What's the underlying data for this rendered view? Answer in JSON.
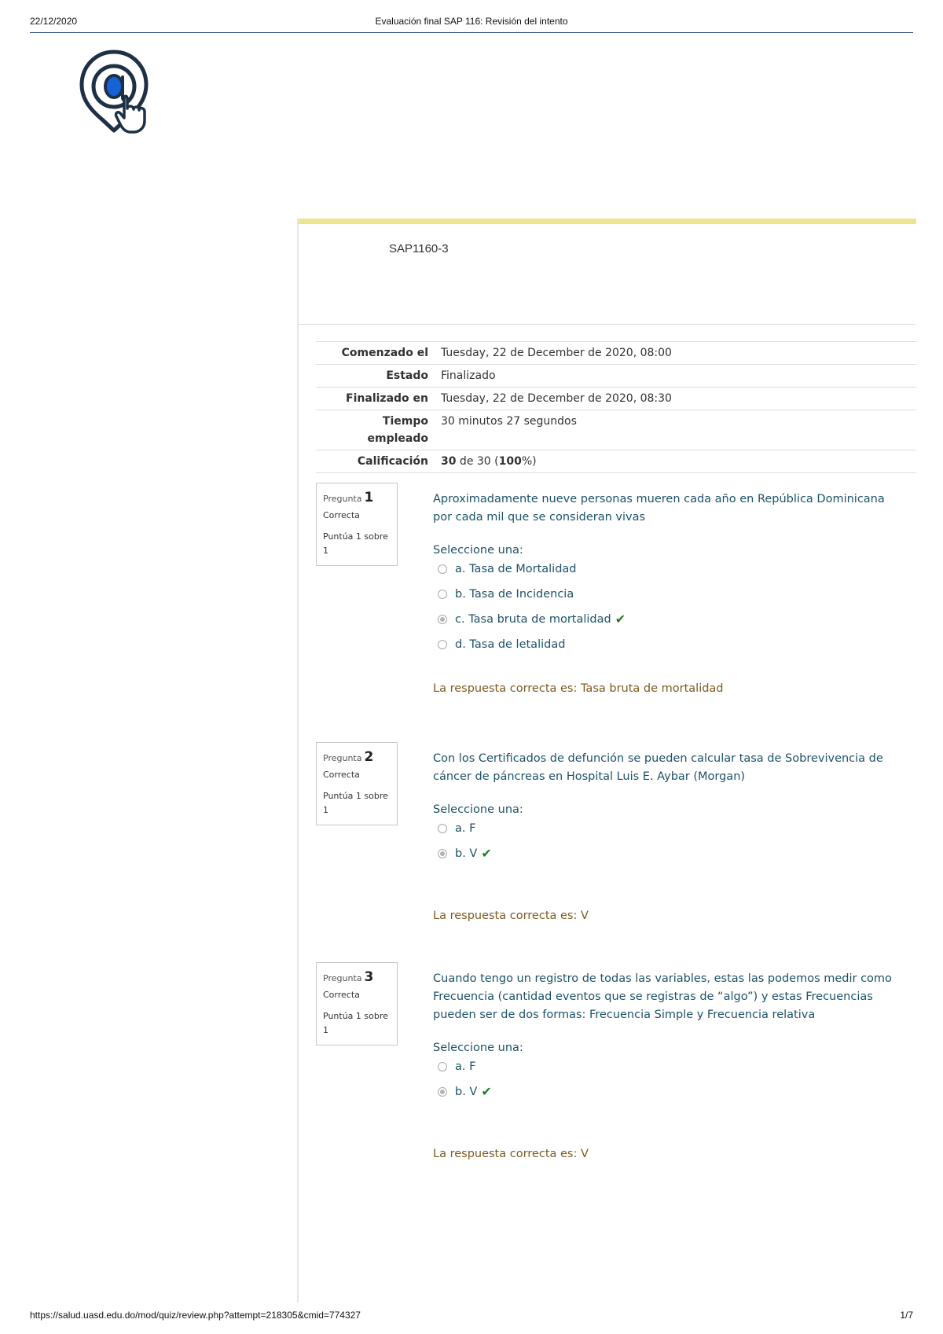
{
  "print_header": {
    "date": "22/12/2020",
    "title": "Evaluación final SAP 116: Revisión del intento"
  },
  "logo": {
    "icon": "at-sign-tap-icon",
    "colors": {
      "outline": "#1e3046",
      "fill": "#1662d6"
    }
  },
  "course_code": "SAP1160-3",
  "summary": [
    {
      "label": "Comenzado el",
      "value": "Tuesday, 22 de December de 2020, 08:00"
    },
    {
      "label": "Estado",
      "value": "Finalizado"
    },
    {
      "label": "Finalizado en",
      "value": "Tuesday, 22 de December de 2020, 08:30"
    },
    {
      "label": "Tiempo empleado",
      "value": "30 minutos 27 segundos"
    },
    {
      "label": "Calificación",
      "value_bold_1": "30",
      "value_mid": " de 30 (",
      "value_bold_2": "100",
      "value_end": "%)"
    }
  ],
  "questions": [
    {
      "label": "Pregunta",
      "number": "1",
      "state": "Correcta",
      "grade": "Puntúa 1 sobre 1",
      "text": "Aproximadamente nueve personas mueren cada año en República Dominicana por cada mil que se consideran vivas",
      "prompt": "Seleccione una:",
      "options": [
        {
          "text": "a. Tasa de Mortalidad"
        },
        {
          "text": "b. Tasa de Incidencia"
        },
        {
          "text": "c. Tasa bruta de mortalidad"
        },
        {
          "text": "d. Tasa de letalidad"
        }
      ],
      "correct_answer": "La respuesta correcta es: Tasa bruta de mortalidad"
    },
    {
      "label": "Pregunta",
      "number": "2",
      "state": "Correcta",
      "grade": "Puntúa 1 sobre 1",
      "text": "Con los Certificados de defunción se pueden calcular tasa de Sobrevivencia de cáncer de páncreas en Hospital Luis E. Aybar (Morgan)",
      "prompt": "Seleccione una:",
      "options": [
        {
          "text": "a. F"
        },
        {
          "text": "b. V"
        }
      ],
      "correct_answer": "La respuesta correcta es: V"
    },
    {
      "label": "Pregunta",
      "number": "3",
      "state": "Correcta",
      "grade": "Puntúa 1 sobre 1",
      "text": "Cuando tengo un registro de todas las variables, estas las podemos medir como Frecuencia (cantidad eventos que se registras de “algo”) y estas Frecuencias pueden ser de dos formas: Frecuencia Simple y Frecuencia relativa",
      "prompt": "Seleccione una:",
      "options": [
        {
          "text": "a. F"
        },
        {
          "text": "b. V"
        }
      ],
      "correct_answer": "La respuesta correcta es: V"
    }
  ],
  "print_footer": {
    "url": "https://salud.uasd.edu.do/mod/quiz/review.php?attempt=218305&cmid=774327",
    "page": "1/7"
  },
  "colors": {
    "accent_bar": "#ece48f",
    "question_text": "#1d5267",
    "correct_answer_text": "#7d5a20",
    "checkmark": "#1e7f1e"
  }
}
